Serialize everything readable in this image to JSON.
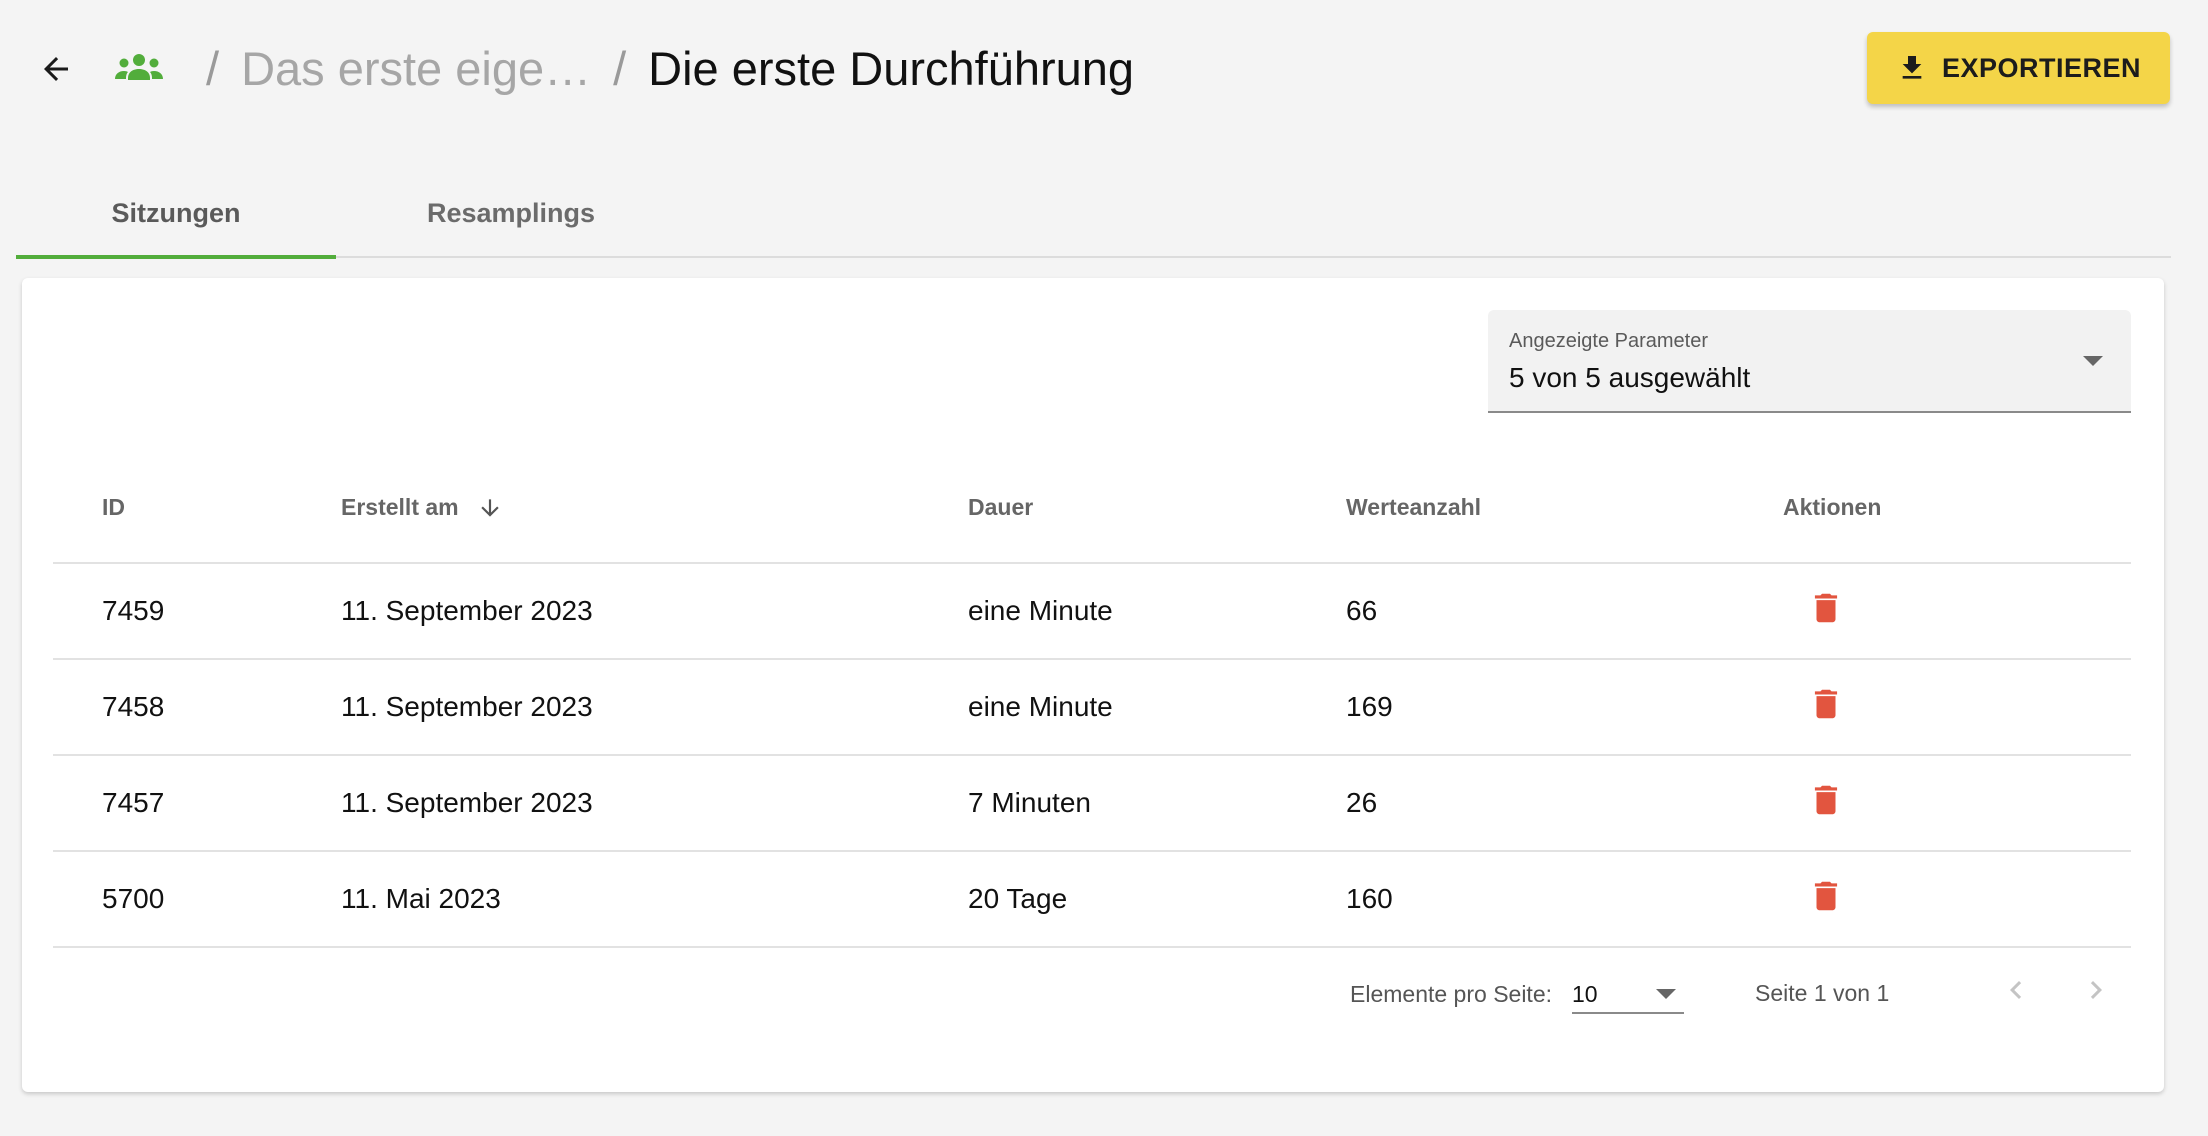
{
  "breadcrumb": {
    "parent": "Das erste eige…",
    "separator": "/",
    "current": "Die erste Durchführung"
  },
  "actions": {
    "export_label": "EXPORTIEREN"
  },
  "tabs": [
    {
      "label": "Sitzungen",
      "active": true
    },
    {
      "label": "Resamplings",
      "active": false
    }
  ],
  "parameter_select": {
    "label": "Angezeigte Parameter",
    "value": "5 von 5 ausgewählt"
  },
  "table": {
    "headers": [
      "ID",
      "Erstellt am",
      "Dauer",
      "Werteanzahl",
      "Aktionen"
    ],
    "sort_column": "Erstellt am",
    "sort_direction": "descending",
    "rows": [
      {
        "id": "7459",
        "created": "11. September 2023",
        "duration": "eine Minute",
        "count": "66"
      },
      {
        "id": "7458",
        "created": "11. September 2023",
        "duration": "eine Minute",
        "count": "169"
      },
      {
        "id": "7457",
        "created": "11. September 2023",
        "duration": "7 Minuten",
        "count": "26"
      },
      {
        "id": "5700",
        "created": "11. Mai 2023",
        "duration": "20 Tage",
        "count": "160"
      }
    ]
  },
  "pagination": {
    "per_page_label": "Elemente pro Seite:",
    "per_page_value": "10",
    "page_info": "Seite 1 von 1"
  },
  "icons": {
    "back": "arrow-left-icon",
    "group": "group-icon",
    "download": "download-icon",
    "sort": "arrow-down-icon",
    "delete": "trash-icon",
    "prev": "chevron-left-icon",
    "next": "chevron-right-icon"
  },
  "colors": {
    "accent_green": "#52ad3b",
    "export_yellow": "#f4d548",
    "delete_red": "#e2553f"
  }
}
